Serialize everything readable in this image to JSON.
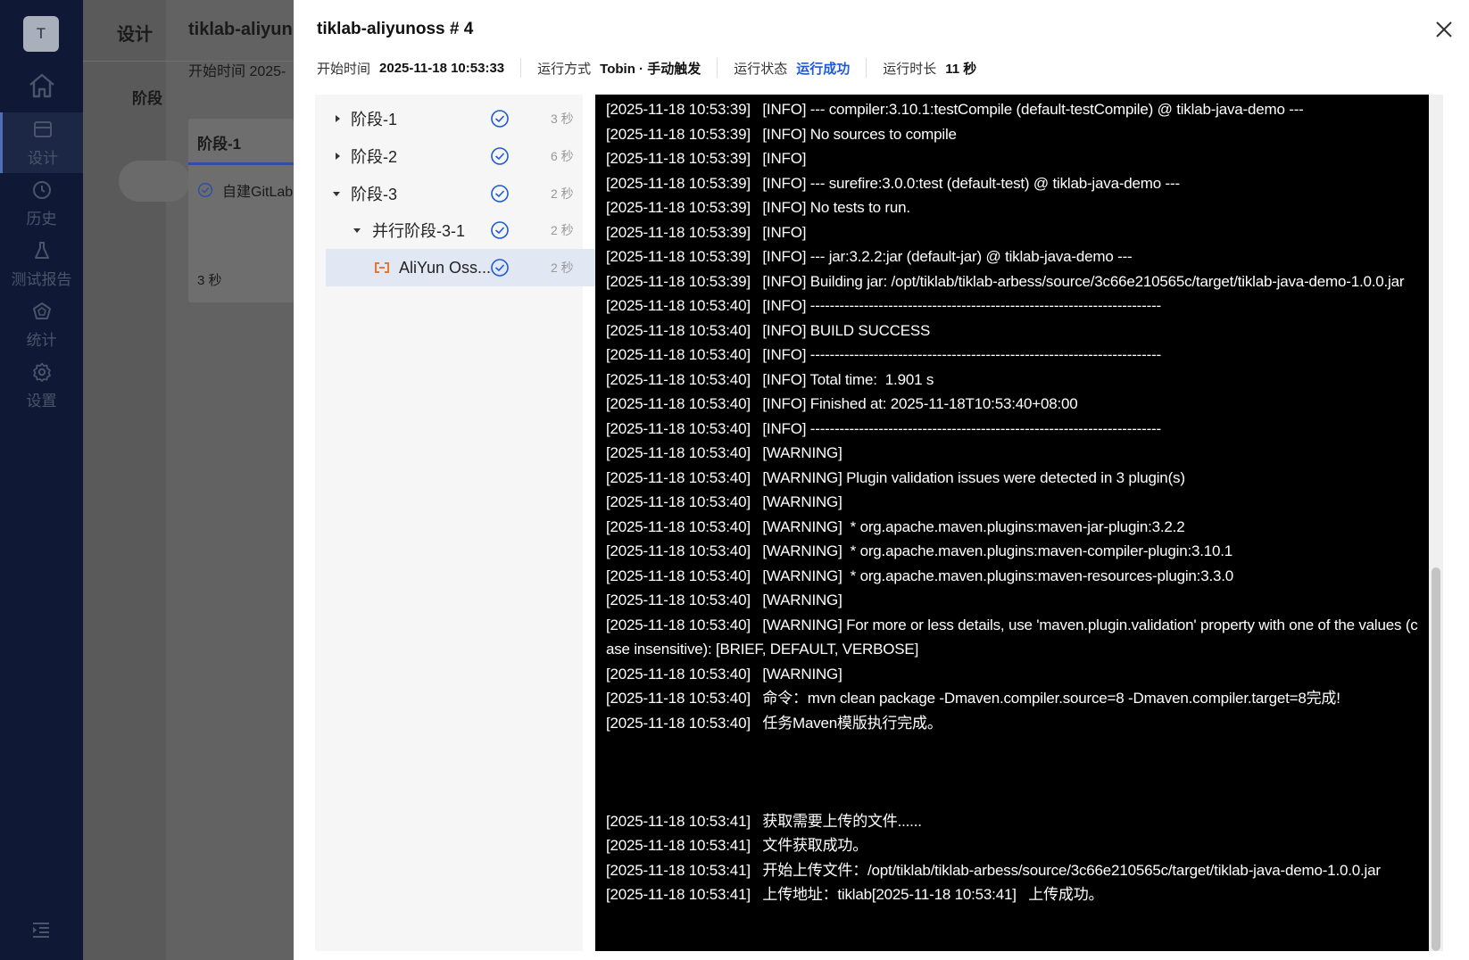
{
  "nav": {
    "avatar": "T",
    "items": [
      {
        "label": "设计",
        "icon": "design-icon",
        "active": true
      },
      {
        "label": "历史",
        "icon": "clock-icon"
      },
      {
        "label": "测试报告",
        "icon": "flask-icon"
      },
      {
        "label": "统计",
        "icon": "chart-icon"
      },
      {
        "label": "设置",
        "icon": "gear-icon"
      }
    ]
  },
  "background": {
    "tab": "设计",
    "pipeline_title": "tiklab-aliyun",
    "start_time": "开始时间  2025-",
    "stage_label": "阶段",
    "stage_card_title": "阶段-1",
    "task": "自建GitLab",
    "duration": "3 秒"
  },
  "drawer": {
    "title": "tiklab-aliyunoss # 4",
    "meta": {
      "start_label": "开始时间",
      "start_value": "2025-11-18 10:53:33",
      "mode_label": "运行方式",
      "mode_value": "Tobin · 手动触发",
      "status_label": "运行状态",
      "status_value": "运行成功",
      "duration_label": "运行时长",
      "duration_value": "11 秒"
    },
    "stages": [
      {
        "label": "阶段-1",
        "time": "3 秒",
        "level": 0,
        "expanded": false
      },
      {
        "label": "阶段-2",
        "time": "6 秒",
        "level": 0,
        "expanded": false
      },
      {
        "label": "阶段-3",
        "time": "2 秒",
        "level": 0,
        "expanded": true
      },
      {
        "label": "并行阶段-3-1",
        "time": "2 秒",
        "level": 1,
        "expanded": true
      },
      {
        "label": "AliYun Oss...",
        "time": "2 秒",
        "level": 2,
        "selected": true
      }
    ],
    "log": [
      "[2025-11-18 10:53:39]   [INFO] --- compiler:3.10.1:testCompile (default-testCompile) @ tiklab-java-demo ---",
      "[2025-11-18 10:53:39]   [INFO] No sources to compile",
      "[2025-11-18 10:53:39]   [INFO]",
      "[2025-11-18 10:53:39]   [INFO] --- surefire:3.0.0:test (default-test) @ tiklab-java-demo ---",
      "[2025-11-18 10:53:39]   [INFO] No tests to run.",
      "[2025-11-18 10:53:39]   [INFO]",
      "[2025-11-18 10:53:39]   [INFO] --- jar:3.2.2:jar (default-jar) @ tiklab-java-demo ---",
      "[2025-11-18 10:53:39]   [INFO] Building jar: /opt/tiklab/tiklab-arbess/source/3c66e210565c/target/tiklab-java-demo-1.0.0.jar",
      "[2025-11-18 10:53:40]   [INFO] ------------------------------------------------------------------------",
      "[2025-11-18 10:53:40]   [INFO] BUILD SUCCESS",
      "[2025-11-18 10:53:40]   [INFO] ------------------------------------------------------------------------",
      "[2025-11-18 10:53:40]   [INFO] Total time:  1.901 s",
      "[2025-11-18 10:53:40]   [INFO] Finished at: 2025-11-18T10:53:40+08:00",
      "[2025-11-18 10:53:40]   [INFO] ------------------------------------------------------------------------",
      "[2025-11-18 10:53:40]   [WARNING]",
      "[2025-11-18 10:53:40]   [WARNING] Plugin validation issues were detected in 3 plugin(s)",
      "[2025-11-18 10:53:40]   [WARNING]",
      "[2025-11-18 10:53:40]   [WARNING]  * org.apache.maven.plugins:maven-jar-plugin:3.2.2",
      "[2025-11-18 10:53:40]   [WARNING]  * org.apache.maven.plugins:maven-compiler-plugin:3.10.1",
      "[2025-11-18 10:53:40]   [WARNING]  * org.apache.maven.plugins:maven-resources-plugin:3.3.0",
      "[2025-11-18 10:53:40]   [WARNING]",
      "[2025-11-18 10:53:40]   [WARNING] For more or less details, use 'maven.plugin.validation' property with one of the values (case insensitive): [BRIEF, DEFAULT, VERBOSE]",
      "[2025-11-18 10:53:40]   [WARNING]",
      "[2025-11-18 10:53:40]   命令：mvn clean package -Dmaven.compiler.source=8 -Dmaven.compiler.target=8完成!",
      "[2025-11-18 10:53:40]   任务Maven模版执行完成。",
      "",
      "",
      "",
      "[2025-11-18 10:53:41]   获取需要上传的文件......",
      "[2025-11-18 10:53:41]   文件获取成功。",
      "[2025-11-18 10:53:41]   开始上传文件：/opt/tiklab/tiklab-arbess/source/3c66e210565c/target/tiklab-java-demo-1.0.0.jar",
      "[2025-11-18 10:53:41]   上传地址：tiklab[2025-11-18 10:53:41]   上传成功。"
    ]
  }
}
